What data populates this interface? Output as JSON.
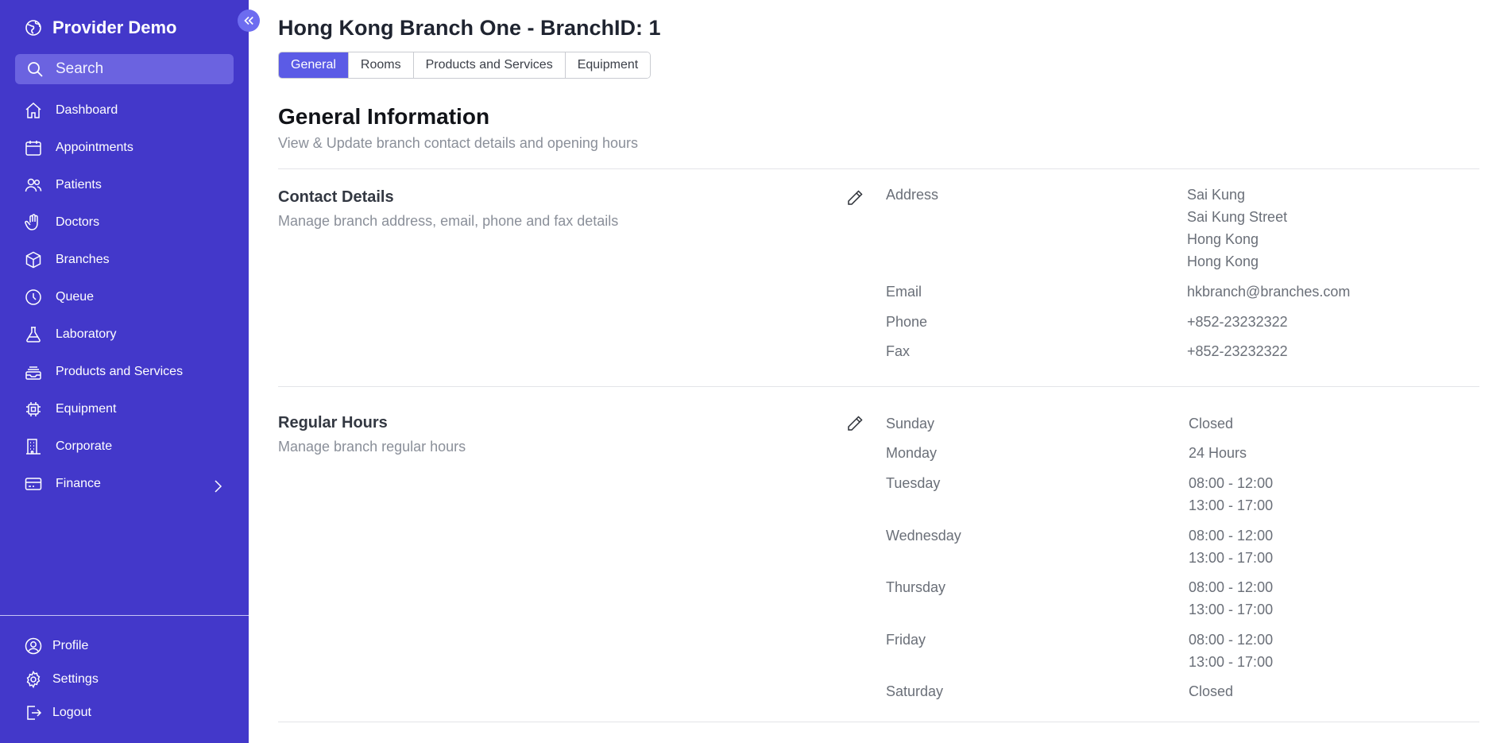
{
  "sidebar": {
    "brand": "Provider Demo",
    "search_placeholder": "Search",
    "items": [
      {
        "label": "Dashboard",
        "icon": "home-icon"
      },
      {
        "label": "Appointments",
        "icon": "calendar-icon"
      },
      {
        "label": "Patients",
        "icon": "users-icon"
      },
      {
        "label": "Doctors",
        "icon": "hand-icon"
      },
      {
        "label": "Branches",
        "icon": "cube-icon"
      },
      {
        "label": "Queue",
        "icon": "clock-icon"
      },
      {
        "label": "Laboratory",
        "icon": "flask-icon"
      },
      {
        "label": "Products and Services",
        "icon": "inbox-stack-icon"
      },
      {
        "label": "Equipment",
        "icon": "chip-icon"
      },
      {
        "label": "Corporate",
        "icon": "building-icon"
      },
      {
        "label": "Finance",
        "icon": "credit-card-icon",
        "has_submenu": true
      }
    ],
    "bottom": [
      {
        "label": "Profile",
        "icon": "user-circle-icon"
      },
      {
        "label": "Settings",
        "icon": "gear-icon"
      },
      {
        "label": "Logout",
        "icon": "logout-icon"
      }
    ]
  },
  "header": {
    "title": "Hong Kong Branch One - BranchID: 1",
    "tabs": [
      {
        "label": "General",
        "active": true
      },
      {
        "label": "Rooms",
        "active": false
      },
      {
        "label": "Products and Services",
        "active": false
      },
      {
        "label": "Equipment",
        "active": false
      }
    ]
  },
  "general": {
    "title": "General Information",
    "subtitle": "View & Update branch contact details and opening hours"
  },
  "contact": {
    "title": "Contact Details",
    "subtitle": "Manage branch address, email, phone and fax details",
    "address_label": "Address",
    "address_lines": [
      "Sai Kung",
      "Sai Kung Street",
      "Hong Kong",
      "Hong Kong"
    ],
    "email_label": "Email",
    "email": "hkbranch@branches.com",
    "phone_label": "Phone",
    "phone": "+852-23232322",
    "fax_label": "Fax",
    "fax": "+852-23232322"
  },
  "hours": {
    "title": "Regular Hours",
    "subtitle": "Manage branch regular hours",
    "days": [
      {
        "day": "Sunday",
        "lines": [
          "Closed"
        ]
      },
      {
        "day": "Monday",
        "lines": [
          "24 Hours"
        ]
      },
      {
        "day": "Tuesday",
        "lines": [
          "08:00 - 12:00",
          "13:00 - 17:00"
        ]
      },
      {
        "day": "Wednesday",
        "lines": [
          "08:00 - 12:00",
          "13:00 - 17:00"
        ]
      },
      {
        "day": "Thursday",
        "lines": [
          "08:00 - 12:00",
          "13:00 - 17:00"
        ]
      },
      {
        "day": "Friday",
        "lines": [
          "08:00 - 12:00",
          "13:00 - 17:00"
        ]
      },
      {
        "day": "Saturday",
        "lines": [
          "Closed"
        ]
      }
    ]
  },
  "colors": {
    "sidebar_bg": "#4338ca",
    "search_bg": "#6b63e0",
    "active_tab": "#5b5be6",
    "collapse_btn": "#6d6cf0"
  }
}
